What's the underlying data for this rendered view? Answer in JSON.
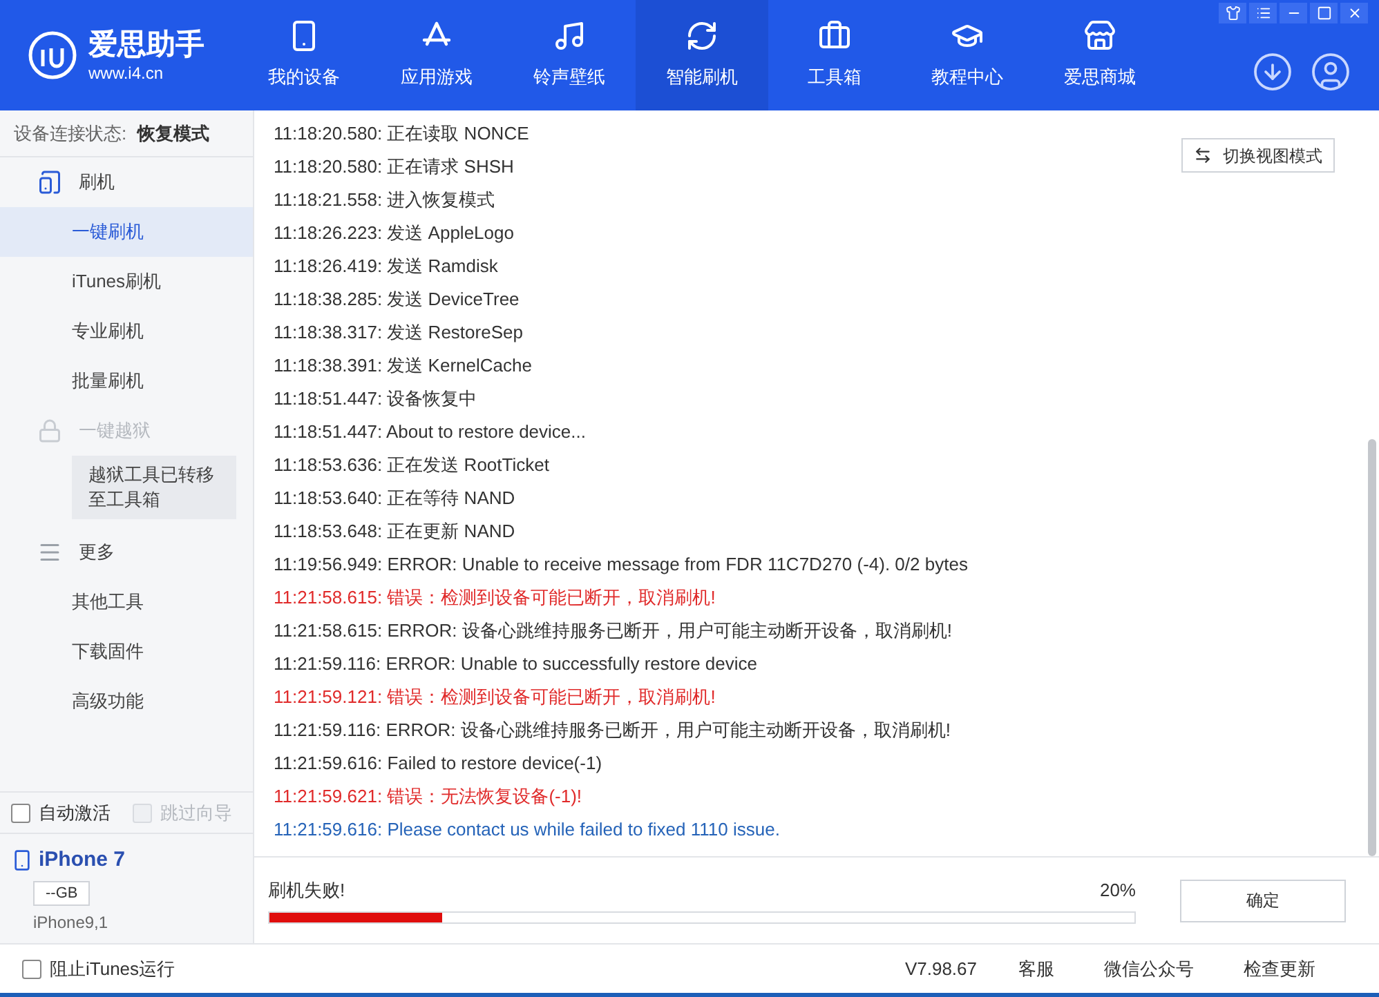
{
  "header": {
    "logo_title": "爱思助手",
    "logo_url": "www.i4.cn",
    "tabs": [
      {
        "label": "我的设备",
        "kind": "device",
        "selected": false
      },
      {
        "label": "应用游戏",
        "kind": "apps",
        "selected": false
      },
      {
        "label": "铃声壁纸",
        "kind": "ringtones",
        "selected": false
      },
      {
        "label": "智能刷机",
        "kind": "flash",
        "selected": true
      },
      {
        "label": "工具箱",
        "kind": "toolbox",
        "selected": false
      },
      {
        "label": "教程中心",
        "kind": "tutorials",
        "selected": false
      },
      {
        "label": "爱思商城",
        "kind": "store",
        "selected": false
      }
    ]
  },
  "sidebar": {
    "status_label": "设备连接状态:",
    "status_value": "恢复模式",
    "groups": [
      {
        "kind": "flash",
        "label": "刷机",
        "disabled": false,
        "items": [
          {
            "label": "一键刷机",
            "selected": true
          },
          {
            "label": "iTunes刷机",
            "selected": false
          },
          {
            "label": "专业刷机",
            "selected": false
          },
          {
            "label": "批量刷机",
            "selected": false
          }
        ]
      },
      {
        "kind": "locked",
        "label": "一键越狱",
        "disabled": true,
        "note": "越狱工具已转移至工具箱"
      },
      {
        "kind": "more",
        "label": "更多",
        "disabled": false,
        "items": [
          {
            "label": "其他工具",
            "selected": false
          },
          {
            "label": "下载固件",
            "selected": false
          },
          {
            "label": "高级功能",
            "selected": false
          }
        ]
      }
    ],
    "options": [
      {
        "label": "自动激活",
        "checked": false,
        "disabled": false
      },
      {
        "label": "跳过向导",
        "checked": false,
        "disabled": true
      }
    ],
    "device": {
      "name": "iPhone 7",
      "storage": "--GB",
      "model": "iPhone9,1"
    }
  },
  "view_toggle": "切换视图模式",
  "log": [
    {
      "time": "11:18:20.580:",
      "text": "正在读取 NONCE",
      "kind": "normal"
    },
    {
      "time": "11:18:20.580:",
      "text": "正在请求 SHSH",
      "kind": "normal"
    },
    {
      "time": "11:18:21.558:",
      "text": "进入恢复模式",
      "kind": "normal"
    },
    {
      "time": "11:18:26.223:",
      "text": "发送 AppleLogo",
      "kind": "normal"
    },
    {
      "time": "11:18:26.419:",
      "text": "发送 Ramdisk",
      "kind": "normal"
    },
    {
      "time": "11:18:38.285:",
      "text": "发送 DeviceTree",
      "kind": "normal"
    },
    {
      "time": "11:18:38.317:",
      "text": "发送 RestoreSep",
      "kind": "normal"
    },
    {
      "time": "11:18:38.391:",
      "text": "发送 KernelCache",
      "kind": "normal"
    },
    {
      "time": "11:18:51.447:",
      "text": "设备恢复中",
      "kind": "normal"
    },
    {
      "time": "11:18:51.447:",
      "text": "About to restore device...",
      "kind": "normal"
    },
    {
      "time": "11:18:53.636:",
      "text": "正在发送 RootTicket",
      "kind": "normal"
    },
    {
      "time": "11:18:53.640:",
      "text": "正在等待 NAND",
      "kind": "normal"
    },
    {
      "time": "11:18:53.648:",
      "text": "正在更新 NAND",
      "kind": "normal"
    },
    {
      "time": "11:19:56.949:",
      "text": "ERROR: Unable to receive message from FDR 11C7D270 (-4). 0/2 bytes",
      "kind": "normal"
    },
    {
      "time": "11:21:58.615:",
      "text": "错误：检测到设备可能已断开，取消刷机!",
      "kind": "error"
    },
    {
      "time": "11:21:58.615:",
      "text": "ERROR: 设备心跳维持服务已断开，用户可能主动断开设备，取消刷机!",
      "kind": "normal"
    },
    {
      "time": "11:21:59.116:",
      "text": "ERROR: Unable to successfully restore device",
      "kind": "normal"
    },
    {
      "time": "11:21:59.121:",
      "text": "错误：检测到设备可能已断开，取消刷机!",
      "kind": "error"
    },
    {
      "time": "11:21:59.116:",
      "text": "ERROR: 设备心跳维持服务已断开，用户可能主动断开设备，取消刷机!",
      "kind": "normal"
    },
    {
      "time": "11:21:59.616:",
      "text": "Failed to restore device(-1)",
      "kind": "normal"
    },
    {
      "time": "11:21:59.621:",
      "text": "错误：无法恢复设备(-1)!",
      "kind": "error"
    },
    {
      "time": "11:21:59.616:",
      "text": "Please contact us while failed to fixed 1110 issue.",
      "kind": "info"
    }
  ],
  "progress": {
    "status": "刷机失败!",
    "percent": "20%",
    "level": 0.2,
    "button": "确定"
  },
  "footer": {
    "block_itunes": {
      "label": "阻止iTunes运行",
      "checked": false
    },
    "version": "V7.98.67",
    "links": [
      "客服",
      "微信公众号",
      "检查更新"
    ]
  }
}
